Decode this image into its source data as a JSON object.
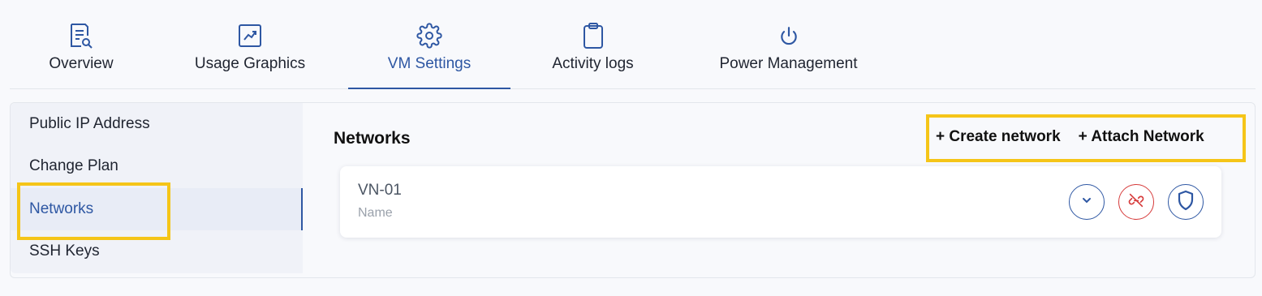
{
  "tabs": [
    {
      "label": "Overview",
      "icon": "report-search-icon"
    },
    {
      "label": "Usage Graphics",
      "icon": "chart-trend-icon"
    },
    {
      "label": "VM Settings",
      "icon": "gear-icon",
      "active": true
    },
    {
      "label": "Activity logs",
      "icon": "clipboard-icon"
    },
    {
      "label": "Power Management",
      "icon": "power-icon"
    }
  ],
  "sidebar": {
    "items": [
      {
        "label": "Public IP Address"
      },
      {
        "label": "Change Plan"
      },
      {
        "label": "Networks",
        "active": true
      },
      {
        "label": "SSH Keys"
      }
    ]
  },
  "main": {
    "title": "Networks",
    "create_label": "+ Create network",
    "attach_label": "+ Attach Network",
    "networks": [
      {
        "name": "VN-01",
        "sub_label": "Name"
      }
    ]
  },
  "colors": {
    "accent": "#2e57a3",
    "danger": "#d63a3a",
    "highlight": "#f5c518"
  }
}
